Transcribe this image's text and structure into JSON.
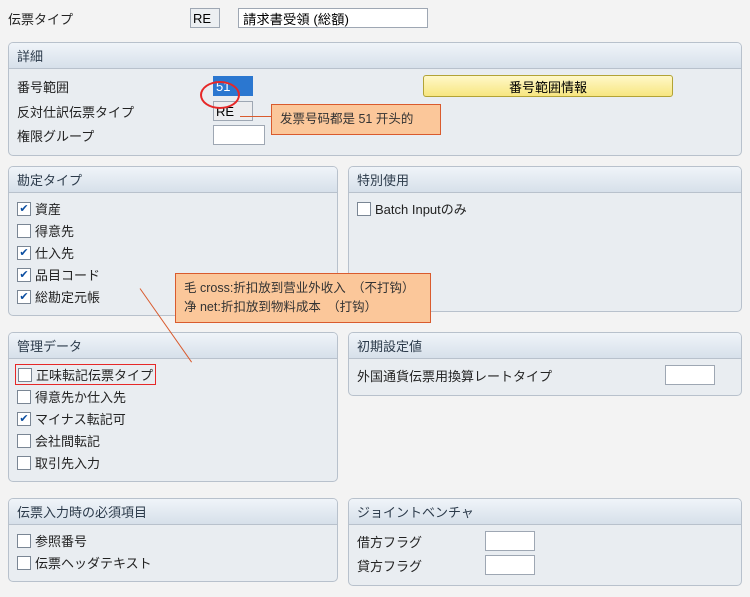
{
  "header": {
    "label": "伝票タイプ",
    "code": "RE",
    "desc": "請求書受領 (総額)"
  },
  "detail": {
    "title": "詳細",
    "num_range_label": "番号範囲",
    "num_range_val": "51",
    "rev_type_label": "反対仕訳伝票タイプ",
    "rev_type_val": "RE",
    "auth_group_label": "権限グループ",
    "auth_group_val": "",
    "info_btn": "番号範囲情報"
  },
  "callout1": "发票号码都是 51 开头的",
  "account_type": {
    "title": "勘定タイプ",
    "items": [
      {
        "label": "資産",
        "checked": true
      },
      {
        "label": "得意先",
        "checked": false
      },
      {
        "label": "仕入先",
        "checked": true
      },
      {
        "label": "品目コード",
        "checked": true
      },
      {
        "label": "総勘定元帳",
        "checked": true
      }
    ]
  },
  "special": {
    "title": "特別使用",
    "batch_label": "Batch Inputのみ",
    "batch_checked": false
  },
  "callout2_l1": "毛 cross:折扣放到营业外收入　（不打钩）",
  "callout2_l2": "净 net:折扣放到物料成本　（打钩）",
  "admin": {
    "title": "管理データ",
    "items": [
      {
        "label": "正味転記伝票タイプ",
        "checked": false,
        "highlight": true
      },
      {
        "label": "得意先か仕入先",
        "checked": false
      },
      {
        "label": "マイナス転記可",
        "checked": true
      },
      {
        "label": "会社間転記",
        "checked": false
      },
      {
        "label": "取引先入力",
        "checked": false
      }
    ]
  },
  "initial": {
    "title": "初期設定値",
    "fx_label": "外国通貨伝票用換算レートタイプ",
    "fx_val": ""
  },
  "required": {
    "title": "伝票入力時の必須項目",
    "items": [
      {
        "label": "参照番号",
        "checked": false
      },
      {
        "label": "伝票ヘッダテキスト",
        "checked": false
      }
    ]
  },
  "jv": {
    "title": "ジョイントベンチャ",
    "debit_label": "借方フラグ",
    "debit_val": "",
    "credit_label": "貸方フラグ",
    "credit_val": ""
  }
}
